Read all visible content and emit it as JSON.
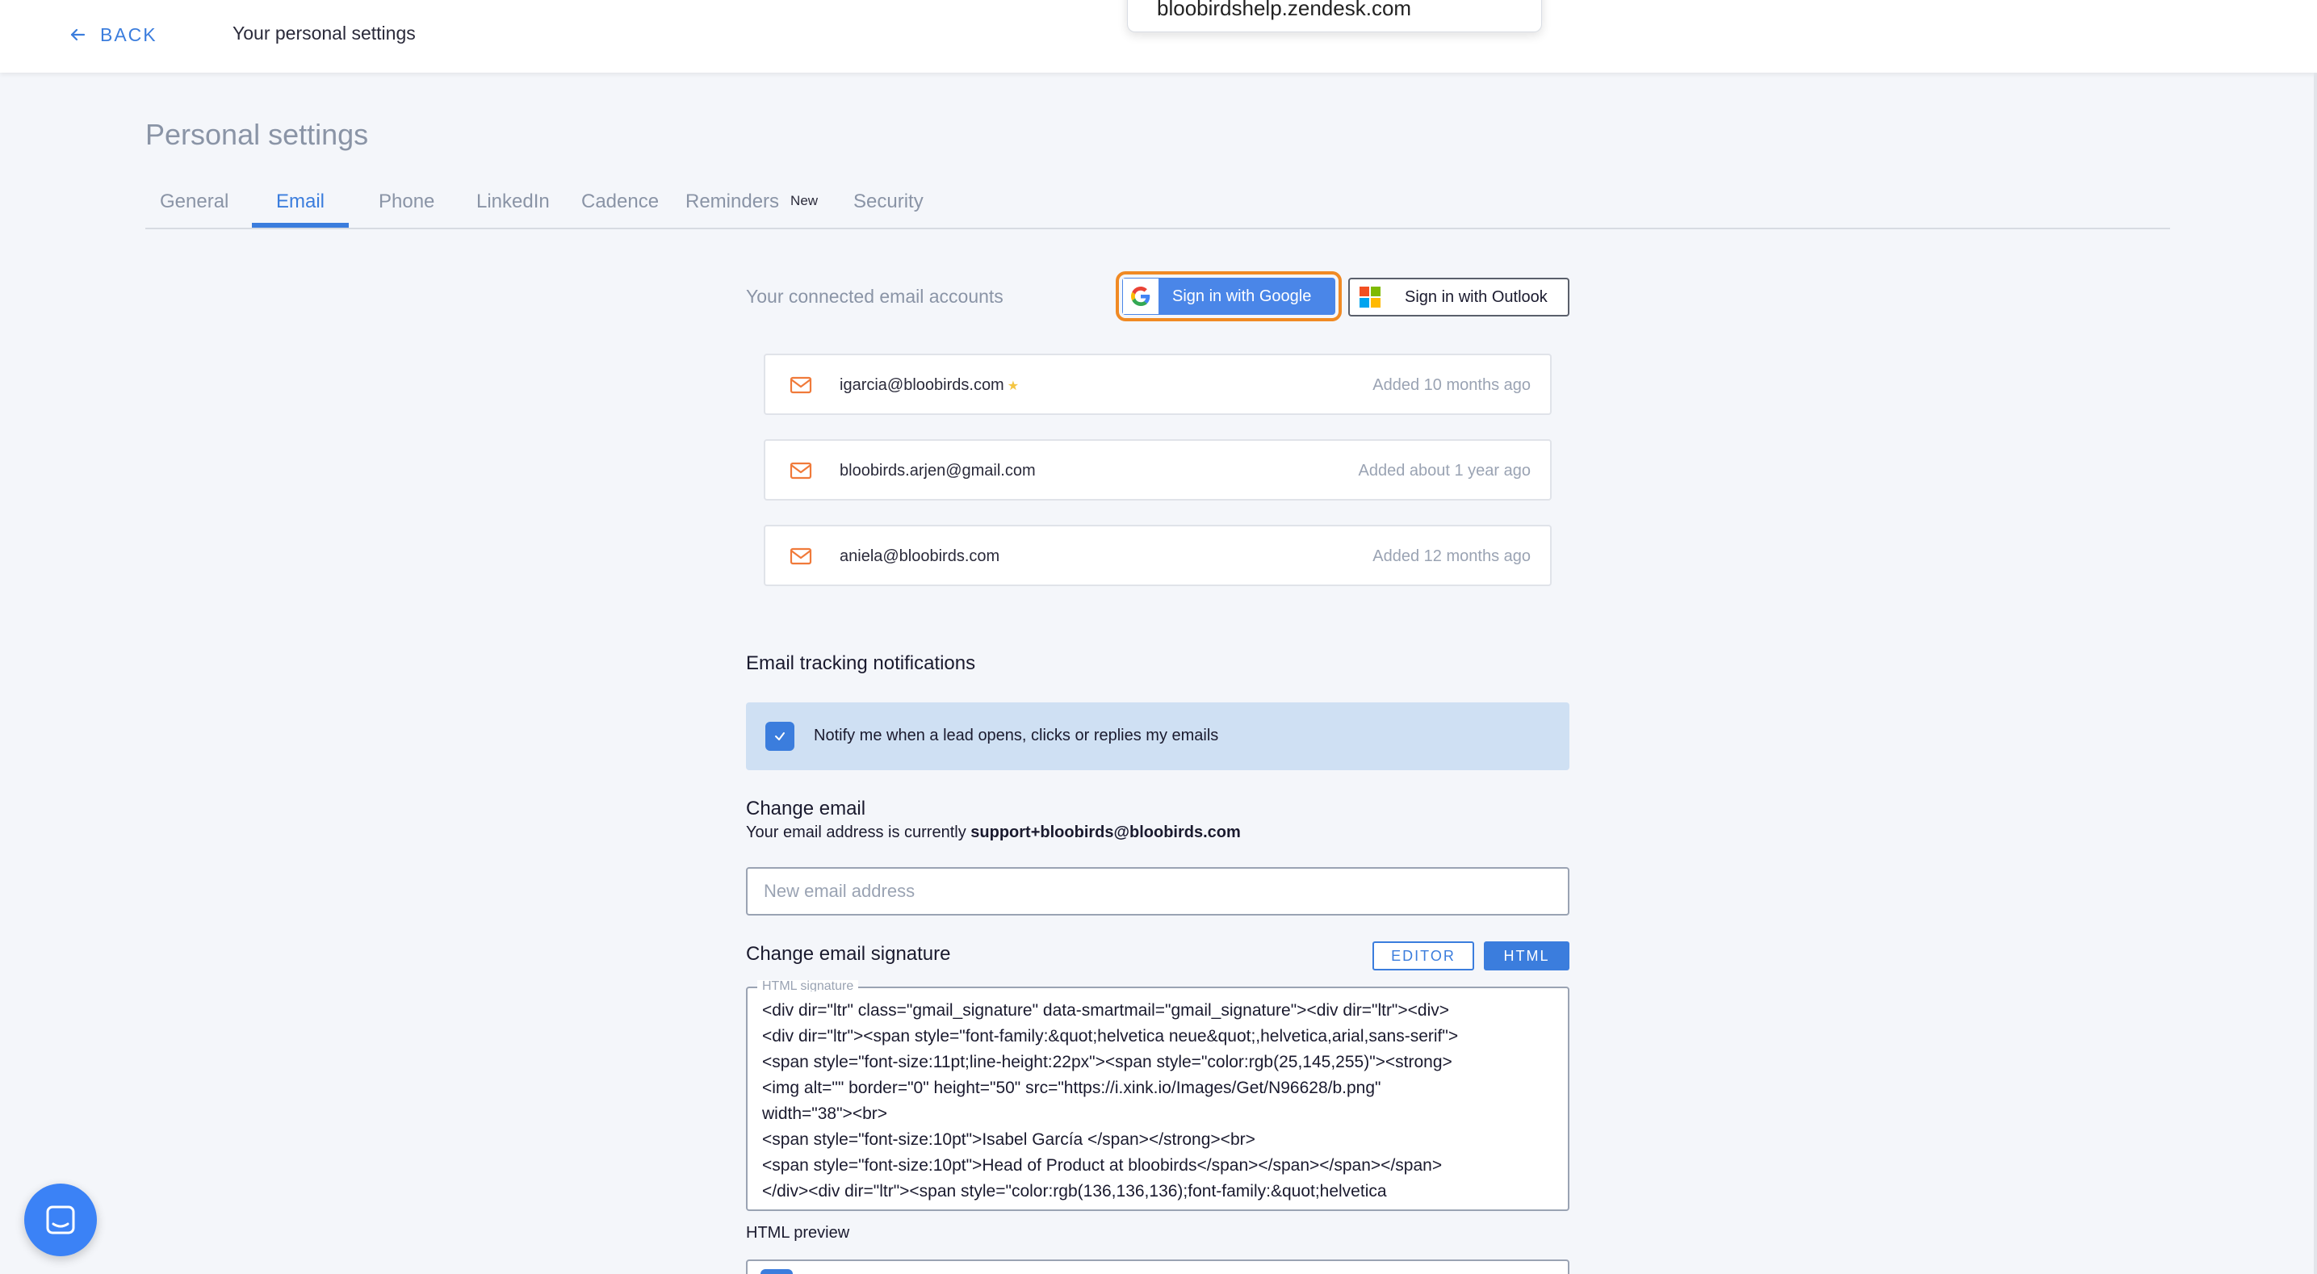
{
  "topbar": {
    "back_label": "BACK",
    "title": "Your personal settings",
    "dropdown_text": "bloobirdshelp.zendesk.com"
  },
  "page": {
    "title": "Personal settings"
  },
  "tabs": [
    {
      "label": "General",
      "active": false
    },
    {
      "label": "Email",
      "active": true
    },
    {
      "label": "Phone",
      "active": false
    },
    {
      "label": "LinkedIn",
      "active": false
    },
    {
      "label": "Cadence",
      "active": false
    },
    {
      "label": "Reminders",
      "active": false,
      "badge": "New"
    },
    {
      "label": "Security",
      "active": false
    }
  ],
  "accounts_section": {
    "label": "Your connected email accounts",
    "google_label": "Sign in with Google",
    "outlook_label": "Sign in with Outlook",
    "accounts": [
      {
        "email": "igarcia@bloobirds.com",
        "added": "Added 10 months ago",
        "default": true
      },
      {
        "email": "bloobirds.arjen@gmail.com",
        "added": "Added about 1 year ago",
        "default": false
      },
      {
        "email": "aniela@bloobirds.com",
        "added": "Added 12 months ago",
        "default": false
      }
    ]
  },
  "tracking": {
    "heading": "Email tracking notifications",
    "notify_label": "Notify me when a lead opens, clicks or replies my emails",
    "checked": true
  },
  "change_email": {
    "heading": "Change email",
    "current_prefix": "Your email address is currently ",
    "current_email": "support+bloobirds@bloobirds.com",
    "placeholder": "New email address"
  },
  "signature": {
    "heading": "Change email signature",
    "editor_label": "EDITOR",
    "html_label": "HTML",
    "legend": "HTML signature",
    "code": "<div dir=\"ltr\" class=\"gmail_signature\" data-smartmail=\"gmail_signature\"><div dir=\"ltr\"><div>\n<div dir=\"ltr\"><span style=\"font-family:&quot;helvetica neue&quot;,helvetica,arial,sans-serif\">\n<span style=\"font-size:11pt;line-height:22px\"><span style=\"color:rgb(25,145,255)\"><strong>\n<img alt=\"\" border=\"0\" height=\"50\" src=\"https://i.xink.io/Images/Get/N96628/b.png\"\nwidth=\"38\"><br>\n<span style=\"font-size:10pt\">Isabel García </span></strong><br>\n<span style=\"font-size:10pt\">Head of Product at bloobirds</span></span></span></span>\n</div><div dir=\"ltr\"><span style=\"color:rgb(136,136,136);font-family:&quot;helvetica\n",
    "preview_label": "HTML preview"
  },
  "colors": {
    "accent": "#3b7ddd",
    "highlight": "#f08a24",
    "mail_icon": "#f07a3a"
  }
}
